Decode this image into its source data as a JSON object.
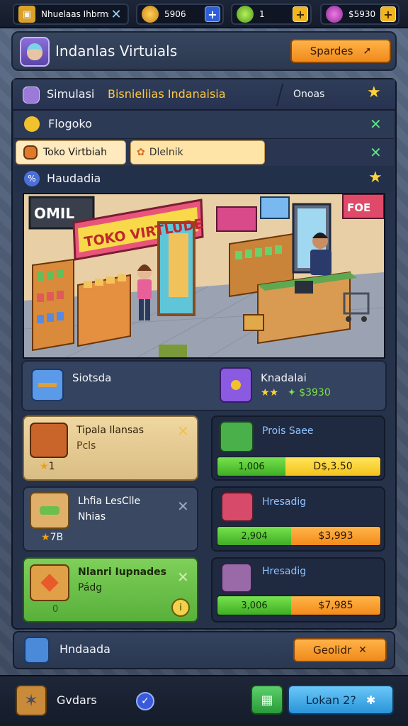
{
  "topbar": {
    "search_label": "Nhuelaas Ihbrms",
    "coins": "5906",
    "gems": "1",
    "cash": "$5930"
  },
  "header": {
    "title": "Indanlas Virtuials",
    "button_label": "Spardes"
  },
  "sim_row": {
    "prefix": "Simulasi",
    "highlight": "Bisnieliias Indanaisia",
    "right_label": "Onoas"
  },
  "section_row": {
    "label": "Flogoko"
  },
  "tabs": [
    {
      "label": "Toko Virtbiah"
    },
    {
      "label": "Dlelnik"
    }
  ],
  "head_row": {
    "label": "Haudadia"
  },
  "scene": {
    "sign_left": "OMIL",
    "sign_main": "TOKO VIRTLUDE",
    "sign_right": "FOE"
  },
  "stats": {
    "left_label": "Siotsda",
    "right_label": "Knadalai",
    "right_value": "$3930"
  },
  "cards": [
    {
      "title": "Tipala Ilansas",
      "sub": "Pcls",
      "rating": "1"
    },
    {
      "title": "Lhfia LesClle",
      "sub": "Nhias",
      "rating": "7B"
    },
    {
      "title": "Nlanri Iupnades",
      "sub": "Pádg",
      "rating": "0"
    }
  ],
  "right_cards": [
    {
      "label": "Prois Saee",
      "green": "1,006",
      "value": "D$,3.50",
      "style": "yellow"
    },
    {
      "label": "Hresadig",
      "green": "2,904",
      "value": "$3,993",
      "style": "orange"
    },
    {
      "label": "Hresadig",
      "green": "3,006",
      "value": "$7,985",
      "style": "orange"
    }
  ],
  "footer": {
    "label": "Hndaada",
    "button_label": "Geolidr"
  },
  "bottom": {
    "label": "Gvdars",
    "button_label": "Lokan 2?"
  },
  "colors": {
    "accent_orange": "#f08a1c",
    "accent_green": "#3fae24",
    "accent_yellow": "#f4c21b",
    "panel_bg": "#26324a"
  }
}
